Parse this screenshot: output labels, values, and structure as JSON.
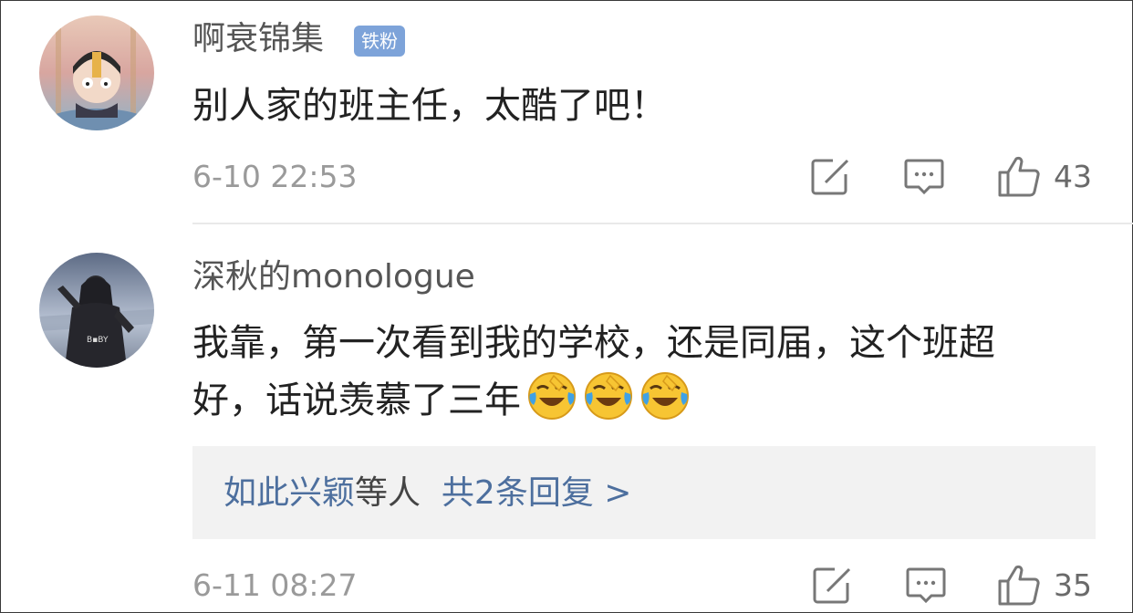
{
  "comments": [
    {
      "username": "啊衰锦集",
      "badge": "铁粉",
      "content": "别人家的班主任，太酷了吧！",
      "time": "6-10 22:53",
      "likes": "43"
    },
    {
      "username": "深秋的monologue",
      "content_line1": "我靠，第一次看到我的学校，还是同届，这个班超",
      "content_line2": "好，话说羡慕了三年",
      "emoji": "laughing-tears-emoji",
      "emoji_count": 3,
      "replies": {
        "name": "如此兴颖",
        "connector": "等人",
        "summary": "共2条回复 >"
      },
      "time": "6-11 08:27",
      "likes": "35"
    }
  ],
  "icons": [
    "share-icon",
    "comment-icon",
    "like-icon"
  ],
  "colors": {
    "link": "#4d6f9e",
    "badge": "#7da3d9",
    "reply_bg": "#f2f2f2"
  }
}
